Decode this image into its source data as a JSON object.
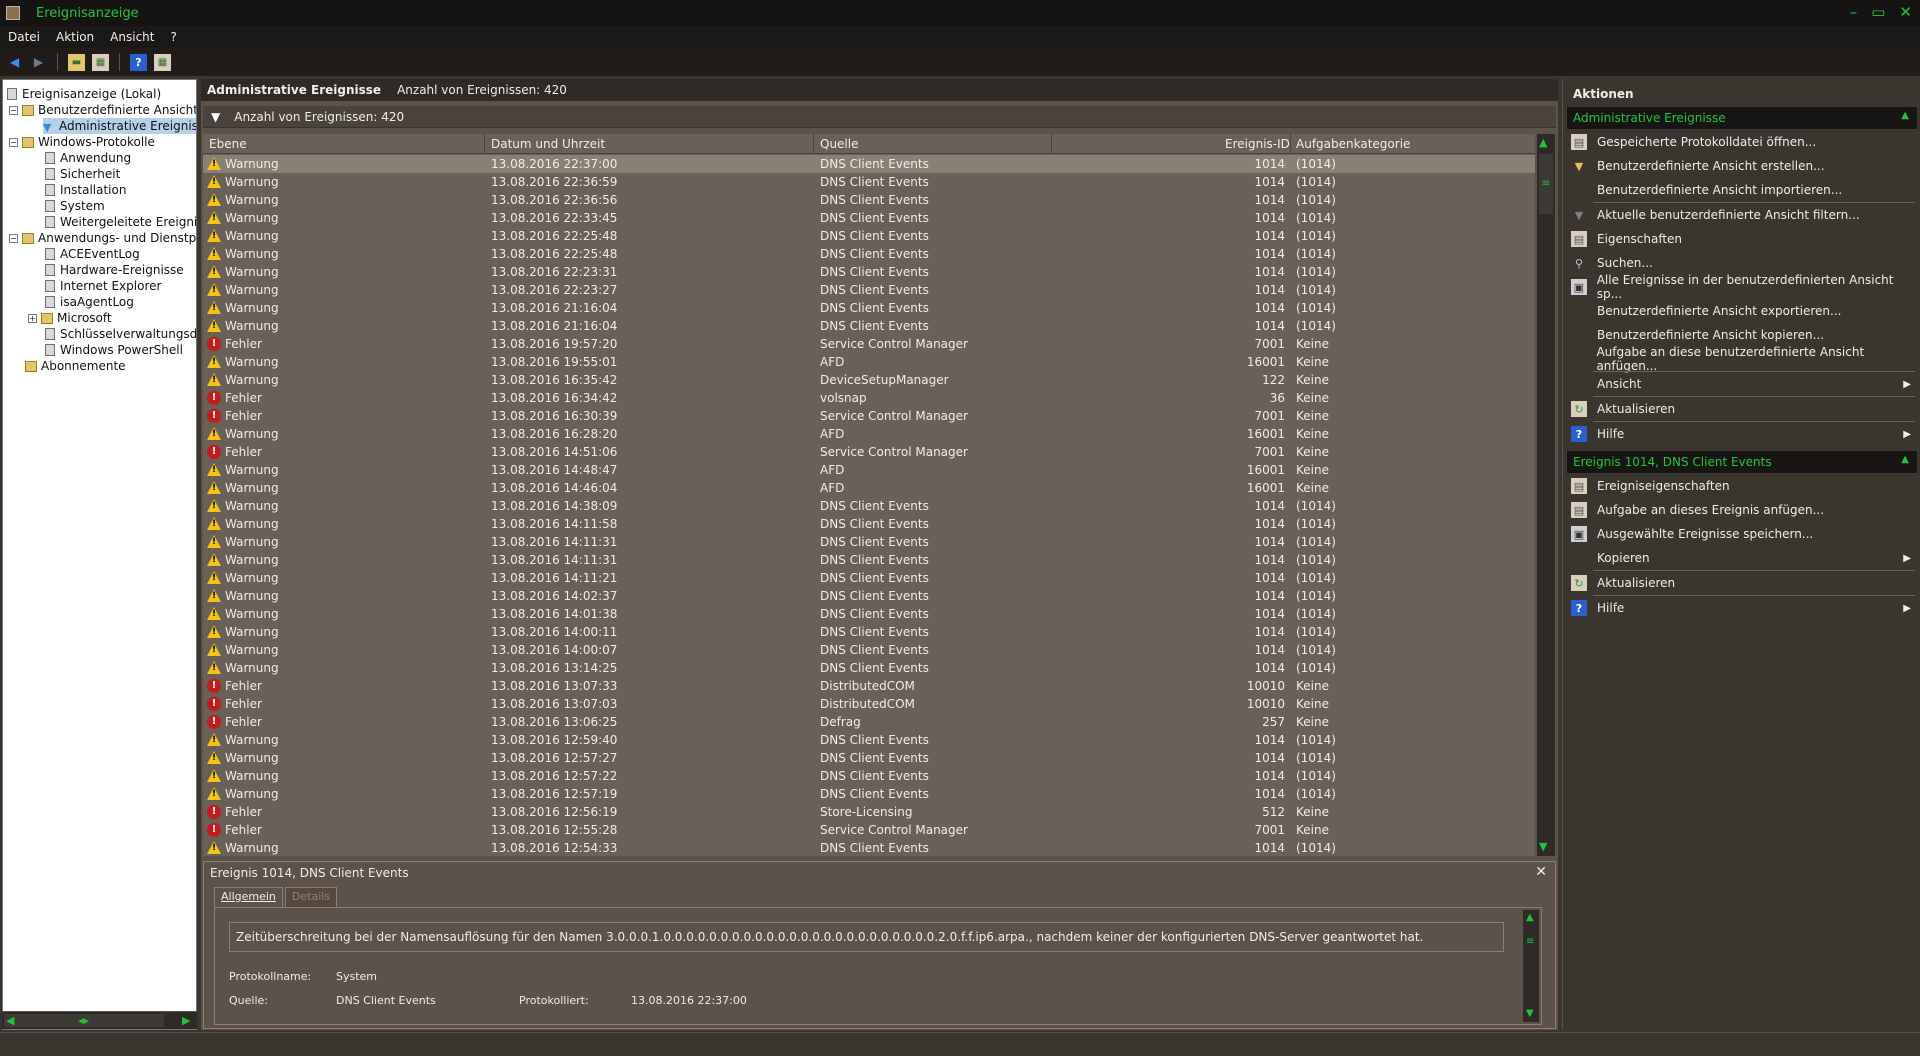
{
  "window": {
    "title": "Ereignisanzeige",
    "minimize": "–",
    "restore": "▭",
    "close": "✕"
  },
  "menu": [
    "Datei",
    "Aktion",
    "Ansicht",
    "?"
  ],
  "tree": {
    "root": "Ereignisanzeige (Lokal)",
    "custom_views": "Benutzerdefinierte Ansichten",
    "admin_events": "Administrative Ereignisse",
    "windows_logs": "Windows-Protokolle",
    "application": "Anwendung",
    "security": "Sicherheit",
    "setup": "Installation",
    "system": "System",
    "forwarded": "Weitergeleitete Ereignisse",
    "apps_services": "Anwendungs- und Dienstprotokolle",
    "ace": "ACEEventLog",
    "hardware": "Hardware-Ereignisse",
    "ie": "Internet Explorer",
    "isa": "isaAgentLog",
    "microsoft": "Microsoft",
    "key_mgmt": "Schlüsselverwaltungsdienst",
    "powershell": "Windows PowerShell",
    "subscriptions": "Abonnemente"
  },
  "center": {
    "title": "Administrative Ereignisse",
    "count_label": "Anzahl von Ereignissen: 420",
    "filter_count": "Anzahl von Ereignissen: 420",
    "columns": {
      "level": "Ebene",
      "date": "Datum und Uhrzeit",
      "source": "Quelle",
      "id": "Ereignis-ID",
      "task": "Aufgabenkategorie"
    },
    "rows": [
      [
        "Warnung",
        "13.08.2016 22:37:00",
        "DNS Client Events",
        "1014",
        "(1014)"
      ],
      [
        "Warnung",
        "13.08.2016 22:36:59",
        "DNS Client Events",
        "1014",
        "(1014)"
      ],
      [
        "Warnung",
        "13.08.2016 22:36:56",
        "DNS Client Events",
        "1014",
        "(1014)"
      ],
      [
        "Warnung",
        "13.08.2016 22:33:45",
        "DNS Client Events",
        "1014",
        "(1014)"
      ],
      [
        "Warnung",
        "13.08.2016 22:25:48",
        "DNS Client Events",
        "1014",
        "(1014)"
      ],
      [
        "Warnung",
        "13.08.2016 22:25:48",
        "DNS Client Events",
        "1014",
        "(1014)"
      ],
      [
        "Warnung",
        "13.08.2016 22:23:31",
        "DNS Client Events",
        "1014",
        "(1014)"
      ],
      [
        "Warnung",
        "13.08.2016 22:23:27",
        "DNS Client Events",
        "1014",
        "(1014)"
      ],
      [
        "Warnung",
        "13.08.2016 21:16:04",
        "DNS Client Events",
        "1014",
        "(1014)"
      ],
      [
        "Warnung",
        "13.08.2016 21:16:04",
        "DNS Client Events",
        "1014",
        "(1014)"
      ],
      [
        "Fehler",
        "13.08.2016 19:57:20",
        "Service Control Manager",
        "7001",
        "Keine"
      ],
      [
        "Warnung",
        "13.08.2016 19:55:01",
        "AFD",
        "16001",
        "Keine"
      ],
      [
        "Warnung",
        "13.08.2016 16:35:42",
        "DeviceSetupManager",
        "122",
        "Keine"
      ],
      [
        "Fehler",
        "13.08.2016 16:34:42",
        "volsnap",
        "36",
        "Keine"
      ],
      [
        "Fehler",
        "13.08.2016 16:30:39",
        "Service Control Manager",
        "7001",
        "Keine"
      ],
      [
        "Warnung",
        "13.08.2016 16:28:20",
        "AFD",
        "16001",
        "Keine"
      ],
      [
        "Fehler",
        "13.08.2016 14:51:06",
        "Service Control Manager",
        "7001",
        "Keine"
      ],
      [
        "Warnung",
        "13.08.2016 14:48:47",
        "AFD",
        "16001",
        "Keine"
      ],
      [
        "Warnung",
        "13.08.2016 14:46:04",
        "AFD",
        "16001",
        "Keine"
      ],
      [
        "Warnung",
        "13.08.2016 14:38:09",
        "DNS Client Events",
        "1014",
        "(1014)"
      ],
      [
        "Warnung",
        "13.08.2016 14:11:58",
        "DNS Client Events",
        "1014",
        "(1014)"
      ],
      [
        "Warnung",
        "13.08.2016 14:11:31",
        "DNS Client Events",
        "1014",
        "(1014)"
      ],
      [
        "Warnung",
        "13.08.2016 14:11:31",
        "DNS Client Events",
        "1014",
        "(1014)"
      ],
      [
        "Warnung",
        "13.08.2016 14:11:21",
        "DNS Client Events",
        "1014",
        "(1014)"
      ],
      [
        "Warnung",
        "13.08.2016 14:02:37",
        "DNS Client Events",
        "1014",
        "(1014)"
      ],
      [
        "Warnung",
        "13.08.2016 14:01:38",
        "DNS Client Events",
        "1014",
        "(1014)"
      ],
      [
        "Warnung",
        "13.08.2016 14:00:11",
        "DNS Client Events",
        "1014",
        "(1014)"
      ],
      [
        "Warnung",
        "13.08.2016 14:00:07",
        "DNS Client Events",
        "1014",
        "(1014)"
      ],
      [
        "Warnung",
        "13.08.2016 13:14:25",
        "DNS Client Events",
        "1014",
        "(1014)"
      ],
      [
        "Fehler",
        "13.08.2016 13:07:33",
        "DistributedCOM",
        "10010",
        "Keine"
      ],
      [
        "Fehler",
        "13.08.2016 13:07:03",
        "DistributedCOM",
        "10010",
        "Keine"
      ],
      [
        "Fehler",
        "13.08.2016 13:06:25",
        "Defrag",
        "257",
        "Keine"
      ],
      [
        "Warnung",
        "13.08.2016 12:59:40",
        "DNS Client Events",
        "1014",
        "(1014)"
      ],
      [
        "Warnung",
        "13.08.2016 12:57:27",
        "DNS Client Events",
        "1014",
        "(1014)"
      ],
      [
        "Warnung",
        "13.08.2016 12:57:22",
        "DNS Client Events",
        "1014",
        "(1014)"
      ],
      [
        "Warnung",
        "13.08.2016 12:57:19",
        "DNS Client Events",
        "1014",
        "(1014)"
      ],
      [
        "Fehler",
        "13.08.2016 12:56:19",
        "Store-Licensing",
        "512",
        "Keine"
      ],
      [
        "Fehler",
        "13.08.2016 12:55:28",
        "Service Control Manager",
        "7001",
        "Keine"
      ],
      [
        "Warnung",
        "13.08.2016 12:54:33",
        "DNS Client Events",
        "1014",
        "(1014)"
      ]
    ]
  },
  "detail": {
    "title": "Ereignis 1014, DNS Client Events",
    "tab_general": "Allgemein",
    "tab_details": "Details",
    "message": "Zeitüberschreitung bei der Namensauflösung für den Namen 3.0.0.0.1.0.0.0.0.0.0.0.0.0.0.0.0.0.0.0.0.0.0.0.0.0.0.0.0.2.0.f.f.ip6.arpa., nachdem keiner der konfigurierten DNS-Server geantwortet hat.",
    "log_name_label": "Protokollname:",
    "log_name_value": "System",
    "source_label": "Quelle:",
    "source_value": "DNS Client Events",
    "logged_label": "Protokolliert:",
    "logged_value": "13.08.2016 22:37:00"
  },
  "actions": {
    "title": "Aktionen",
    "section1": "Administrative Ereignisse",
    "s1_items": [
      "Gespeicherte Protokolldatei öffnen...",
      "Benutzerdefinierte Ansicht erstellen...",
      "Benutzerdefinierte Ansicht importieren...",
      "Aktuelle benutzerdefinierte Ansicht filtern...",
      "Eigenschaften",
      "Suchen...",
      "Alle Ereignisse in der benutzerdefinierten Ansicht sp...",
      "Benutzerdefinierte Ansicht exportieren...",
      "Benutzerdefinierte Ansicht kopieren...",
      "Aufgabe an diese benutzerdefinierte Ansicht anfügen...",
      "Ansicht",
      "Aktualisieren",
      "Hilfe"
    ],
    "section2": "Ereignis 1014, DNS Client Events",
    "s2_items": [
      "Ereigniseigenschaften",
      "Aufgabe an dieses Ereignis anfügen...",
      "Ausgewählte Ereignisse speichern...",
      "Kopieren",
      "Aktualisieren",
      "Hilfe"
    ]
  }
}
